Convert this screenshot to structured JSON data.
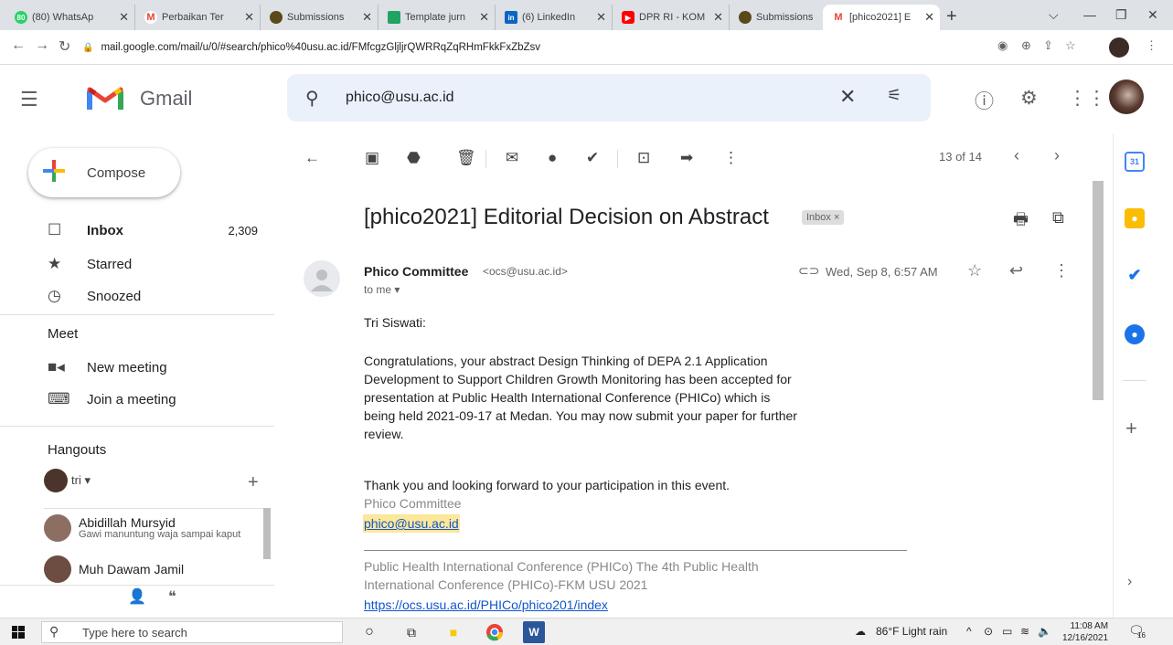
{
  "browser": {
    "tabs": [
      {
        "title": "(80) WhatsAp",
        "color": "#25d366"
      },
      {
        "title": "Perbaikan Ter",
        "color": "#ea4335"
      },
      {
        "title": "Submissions",
        "color": "#5a4a1a"
      },
      {
        "title": "Template jurn",
        "color": "#1fa463"
      },
      {
        "title": "(6) LinkedIn",
        "color": "#0a66c2"
      },
      {
        "title": "DPR RI - KOM",
        "color": "#ff0000"
      },
      {
        "title": "Submissions",
        "color": "#5a4a1a"
      },
      {
        "title": "[phico2021] E",
        "color": "#ea4335"
      }
    ],
    "url": "mail.google.com/mail/u/0/#search/phico%40usu.ac.id/FMfcgzGljljrQWRRqZqRHmFkkFxZbZsv"
  },
  "header": {
    "app_name": "Gmail",
    "search_value": "phico@usu.ac.id"
  },
  "sidebar": {
    "compose_label": "Compose",
    "items": [
      {
        "label": "Inbox",
        "count": "2,309",
        "icon": "inbox-icon"
      },
      {
        "label": "Starred",
        "count": "",
        "icon": "star-icon"
      },
      {
        "label": "Snoozed",
        "count": "",
        "icon": "clock-icon"
      }
    ],
    "meet": {
      "title": "Meet",
      "items": [
        {
          "label": "New meeting",
          "icon": "video-icon"
        },
        {
          "label": "Join a meeting",
          "icon": "keyboard-icon"
        }
      ]
    },
    "hangouts": {
      "title": "Hangouts",
      "self_name": "tri",
      "contacts": [
        {
          "name": "Abidillah Mursyid",
          "status": "Gawi manuntung waja sampai kaput"
        },
        {
          "name": "Muh Dawam Jamil",
          "status": ""
        }
      ]
    }
  },
  "toolbar": {
    "page_count": "13 of 14"
  },
  "message": {
    "subject": "[phico2021] Editorial Decision on Abstract",
    "label_chip": "Inbox ×",
    "sender_name": "Phico Committee",
    "sender_email": "<ocs@usu.ac.id>",
    "to": "to me",
    "date": "Wed, Sep 8, 6:57 AM",
    "greeting": "Tri Siswati:",
    "paragraph_lines": [
      "Congratulations, your abstract Design Thinking of  DEPA 2.1 Application",
      "Development  to Support Children Growth Monitoring has been accepted for",
      "presentation at Public Health International Conference (PHICo) which is",
      "being held 2021-09-17 at Medan. You may now submit your paper for further",
      "review."
    ],
    "thanks": "Thank you and looking forward to your participation in this event.",
    "signature": "Phico Committee",
    "signature_email": "phico@usu.ac.id",
    "footer_lines": [
      "Public Health International Conference (PHICo) The 4th Public Health",
      "International Conference (PHICo)-FKM USU 2021"
    ],
    "footer_link": "https://ocs.usu.ac.id/PHICo/phico201/index"
  },
  "taskbar": {
    "search_placeholder": "Type here to search",
    "weather": "86°F  Light rain",
    "time": "11:08 AM",
    "date": "12/16/2021",
    "notification_count": "16"
  }
}
